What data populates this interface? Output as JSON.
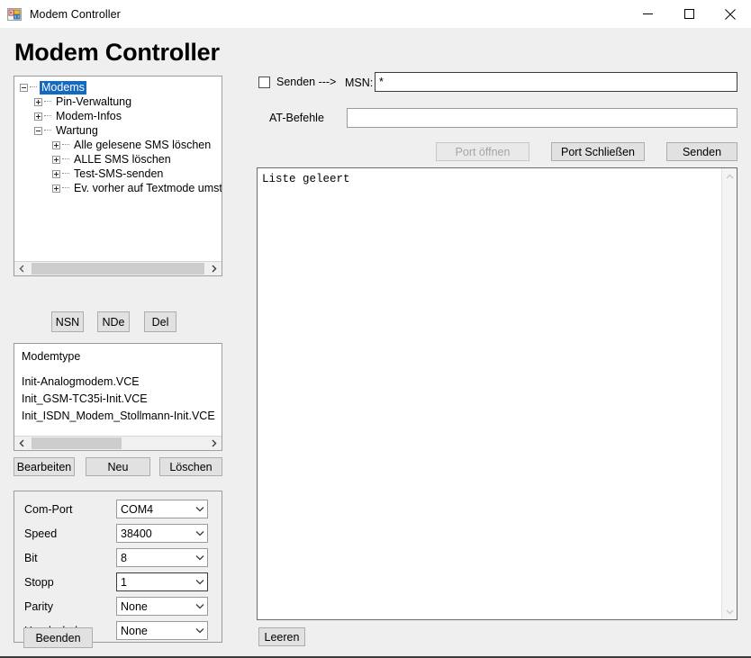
{
  "window": {
    "title": "Modem Controller",
    "icon": "app-form-icon",
    "minimize_label": "—",
    "maximize_label": "□",
    "close_label": "✕"
  },
  "page": {
    "heading": "Modem Controller"
  },
  "tree": {
    "nodes": [
      {
        "label": "Modems",
        "level": 0,
        "toggle": "minus",
        "selected": true
      },
      {
        "label": "Pin-Verwaltung",
        "level": 1,
        "toggle": "plus",
        "selected": false
      },
      {
        "label": "Modem-Infos",
        "level": 1,
        "toggle": "plus",
        "selected": false
      },
      {
        "label": "Wartung",
        "level": 1,
        "toggle": "minus",
        "selected": false
      },
      {
        "label": "Alle gelesene SMS löschen",
        "level": 2,
        "toggle": "plus",
        "selected": false
      },
      {
        "label": "ALLE SMS löschen",
        "level": 2,
        "toggle": "plus",
        "selected": false
      },
      {
        "label": "Test-SMS-senden",
        "level": 2,
        "toggle": "plus",
        "selected": false
      },
      {
        "label": "Ev. vorher auf Textmode umstellen",
        "level": 2,
        "toggle": "plus",
        "selected": false
      }
    ],
    "scroll_left_icon": "chevron-left-icon",
    "scroll_right_icon": "chevron-right-icon"
  },
  "tree_buttons": {
    "nsn": "NSN",
    "nde": "NDe",
    "del": "Del"
  },
  "modemtype": {
    "header": "Modemtype",
    "items": [
      "Init-Analogmodem.VCE",
      "Init_GSM-TC35i-Init.VCE",
      "Init_ISDN_Modem_Stollmann-Init.VCE"
    ]
  },
  "modemtype_buttons": {
    "edit": "Bearbeiten",
    "new": "Neu",
    "delete": "Löschen"
  },
  "serial": {
    "rows": [
      {
        "label": "Com-Port",
        "value": "COM4",
        "focused": false
      },
      {
        "label": "Speed",
        "value": "38400",
        "focused": false
      },
      {
        "label": "Bit",
        "value": "8",
        "focused": false
      },
      {
        "label": "Stopp",
        "value": "1",
        "focused": true
      },
      {
        "label": "Parity",
        "value": "None",
        "focused": false
      },
      {
        "label": "Handschake",
        "value": "None",
        "focused": false
      }
    ]
  },
  "right": {
    "senden_checkbox_label": "Senden --->",
    "senden_checked": false,
    "msn_label": "MSN:",
    "msn_value": "*",
    "at_label": "AT-Befehle",
    "at_value": "",
    "btn_port_open": "Port öffnen",
    "btn_port_open_disabled": true,
    "btn_port_close": "Port Schließen",
    "btn_send": "Senden"
  },
  "output": {
    "text": "Liste geleert",
    "scroll_up_icon": "chevron-up-icon",
    "scroll_down_icon": "chevron-down-icon"
  },
  "footer": {
    "beenden": "Beenden",
    "leeren": "Leeren"
  },
  "colors": {
    "selection": "#1669c0",
    "window_bg": "#efefef",
    "field_bg": "#ffffff",
    "button_bg": "#e1e1e1"
  }
}
